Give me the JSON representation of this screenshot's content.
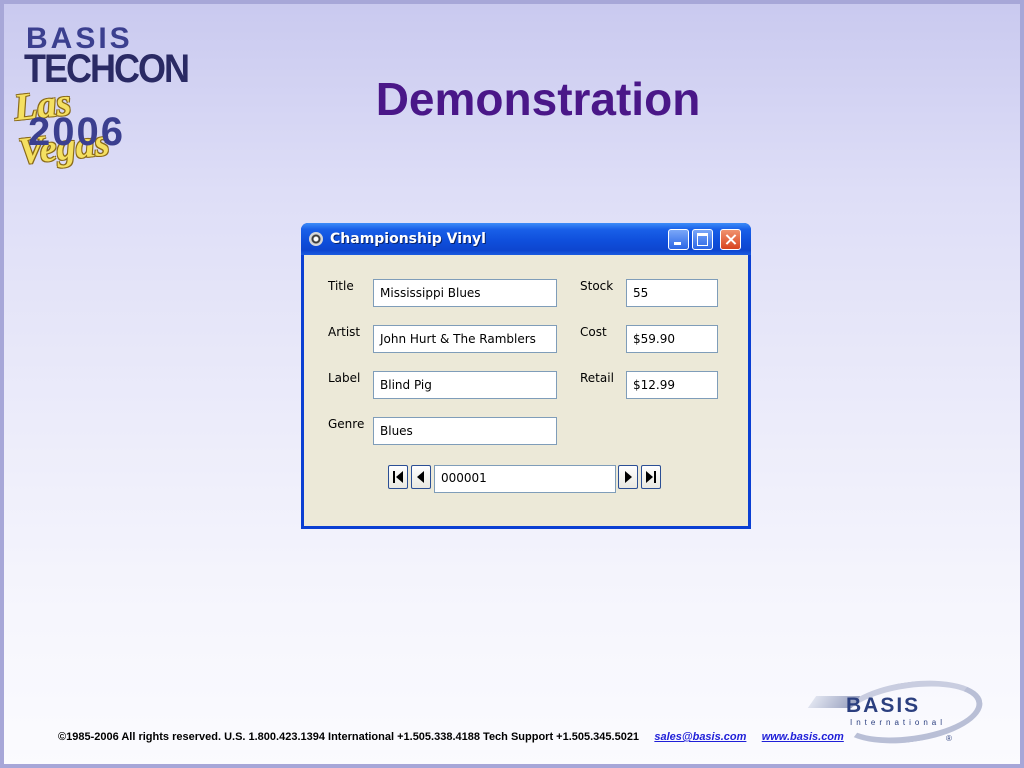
{
  "logo": {
    "line1": "BASIS",
    "line2": "TECHCON",
    "line3": "Las Vegas",
    "line4": "2006"
  },
  "title": "Demonstration",
  "window": {
    "title": "Championship Vinyl",
    "icon": "disc-icon",
    "caption_buttons": [
      "minimize-icon",
      "maximize-icon",
      "close-icon"
    ],
    "fields": {
      "title": {
        "label": "Title",
        "value": "Mississippi Blues"
      },
      "artist": {
        "label": "Artist",
        "value": "John Hurt & The Ramblers"
      },
      "label": {
        "label": "Label",
        "value": "Blind Pig"
      },
      "genre": {
        "label": "Genre",
        "value": "Blues"
      },
      "stock": {
        "label": "Stock",
        "value": "55"
      },
      "cost": {
        "label": "Cost",
        "value": "$59.90"
      },
      "retail": {
        "label": "Retail",
        "value": "$12.99"
      }
    },
    "navigator": {
      "record": "000001",
      "first_icon": "first-record-icon",
      "prev_icon": "previous-record-icon",
      "next_icon": "next-record-icon",
      "last_icon": "last-record-icon"
    }
  },
  "footer": {
    "text": "©1985-2006  All rights reserved.   U.S. 1.800.423.1394    International +1.505.338.4188   Tech Support +1.505.345.5021",
    "email": "sales@basis.com",
    "website": "www.basis.com"
  },
  "brand_logo": {
    "word": "BASIS",
    "sub": "International",
    "mark": "®"
  },
  "colors": {
    "title": "#4a1788",
    "titlebar": "#0f4fdc",
    "window_client": "#ece9d8",
    "footer_link": "#1f1fd8"
  }
}
